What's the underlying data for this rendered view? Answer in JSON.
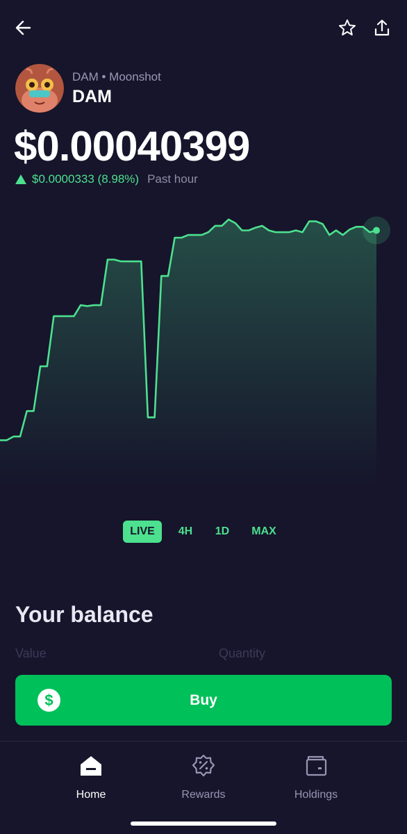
{
  "header": {
    "back_icon": "arrow-left-icon",
    "favorite_icon": "star-outline-icon",
    "share_icon": "share-upload-icon"
  },
  "token": {
    "subtitle": "DAM • Moonshot",
    "name": "DAM",
    "avatar_icon": "frog-avatar-icon"
  },
  "price": {
    "value": "$0.00040399",
    "change": "$0.0000333 (8.98%)",
    "period": "Past hour",
    "direction": "up"
  },
  "colors": {
    "background": "#16152b",
    "accent_green": "#4de08f",
    "buy_green": "#00c05a",
    "muted_text": "#8f8da9"
  },
  "chart_data": {
    "type": "area",
    "x": [
      0,
      1,
      2,
      3,
      4,
      5,
      6,
      7,
      8,
      9,
      10,
      11,
      12,
      13,
      14,
      15,
      16,
      17,
      18,
      19,
      20,
      21,
      22,
      23,
      24,
      25,
      26,
      27,
      28,
      29,
      30,
      31,
      32,
      33,
      34,
      35,
      36,
      37,
      38,
      39,
      40,
      41,
      42,
      43,
      44,
      45,
      46,
      47,
      48,
      49,
      50,
      51,
      52,
      53,
      54,
      55,
      56
    ],
    "values": [
      6.6,
      6.6,
      7.0,
      7.0,
      9.8,
      9.8,
      14.7,
      14.7,
      20.2,
      20.2,
      20.2,
      20.2,
      21.4,
      21.3,
      21.4,
      21.4,
      26.4,
      26.4,
      26.2,
      26.2,
      26.2,
      26.2,
      9.1,
      9.1,
      24.6,
      24.6,
      28.8,
      28.8,
      29.1,
      29.1,
      29.1,
      29.4,
      30.1,
      30.1,
      30.8,
      30.4,
      29.6,
      29.6,
      29.9,
      30.1,
      29.6,
      29.4,
      29.4,
      29.4,
      29.6,
      29.4,
      30.6,
      30.6,
      30.3,
      29.1,
      29.6,
      29.1,
      29.7,
      30.0,
      30.0,
      29.4,
      29.6
    ],
    "ylim": [
      0,
      32
    ],
    "grid": false,
    "endpoint_marker": true
  },
  "ranges": {
    "items": [
      "LIVE",
      "4H",
      "1D",
      "MAX"
    ],
    "selected": "LIVE"
  },
  "balance": {
    "title": "Your balance",
    "value_label": "Value",
    "quantity_label": "Quantity"
  },
  "buy": {
    "label": "Buy",
    "icon": "dollar-circle-icon",
    "icon_glyph": "$"
  },
  "tabs": [
    {
      "label": "Home",
      "icon": "home-icon",
      "active": true
    },
    {
      "label": "Rewards",
      "icon": "rewards-badge-icon",
      "active": false
    },
    {
      "label": "Holdings",
      "icon": "wallet-icon",
      "active": false
    }
  ]
}
